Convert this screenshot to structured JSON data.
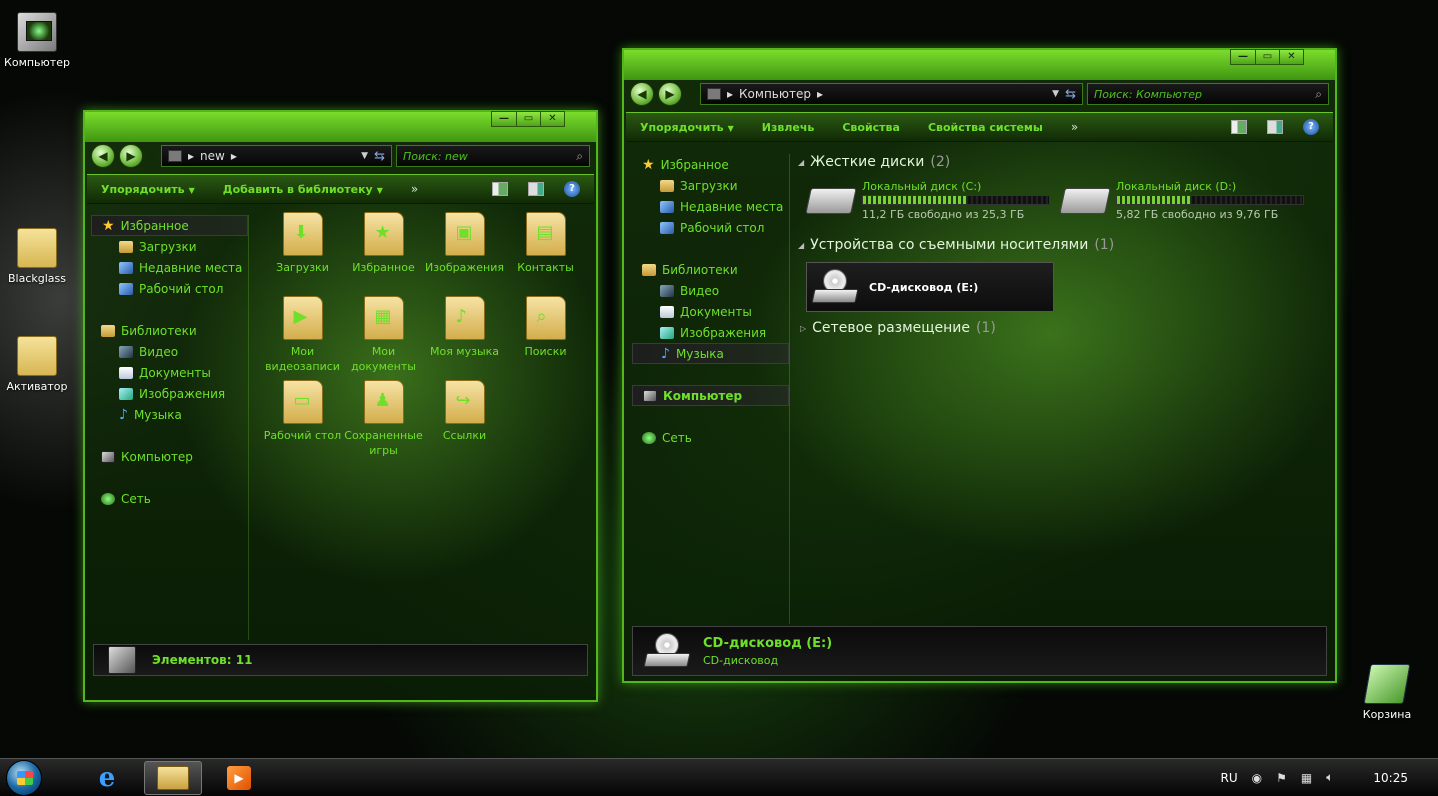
{
  "desktop": {
    "icons": [
      {
        "label": "Компьютер",
        "kind": "computer"
      },
      {
        "label": "Blackglass",
        "kind": "folder"
      },
      {
        "label": "Активатор",
        "kind": "folder"
      },
      {
        "label": "Корзина",
        "kind": "trash"
      }
    ]
  },
  "left_window": {
    "controls": [
      "—",
      "▭",
      "✕"
    ],
    "address": "new",
    "search_placeholder": "Поиск: new",
    "commands": {
      "organize": "Упорядочить",
      "add_library": "Добавить в библиотеку",
      "more": "»"
    },
    "sidebar": {
      "favorites": "Избранное",
      "fav_items": [
        "Загрузки",
        "Недавние места",
        "Рабочий стол"
      ],
      "libraries": "Библиотеки",
      "lib_items": [
        "Видео",
        "Документы",
        "Изображения",
        "Музыка"
      ],
      "computer": "Компьютер",
      "network": "Сеть"
    },
    "items": [
      {
        "label": "Загрузки",
        "glyph": "⬇"
      },
      {
        "label": "Избранное",
        "glyph": "★"
      },
      {
        "label": "Изображения",
        "glyph": "▣"
      },
      {
        "label": "Контакты",
        "glyph": "▤"
      },
      {
        "label": "Мои видеозаписи",
        "glyph": "▶"
      },
      {
        "label": "Мои документы",
        "glyph": "▦"
      },
      {
        "label": "Моя музыка",
        "glyph": "♪"
      },
      {
        "label": "Поиски",
        "glyph": "⌕"
      },
      {
        "label": "Рабочий стол",
        "glyph": "▭"
      },
      {
        "label": "Сохраненные игры",
        "glyph": "♟"
      },
      {
        "label": "Ссылки",
        "glyph": "↪"
      }
    ],
    "status": "Элементов: 11"
  },
  "right_window": {
    "controls": [
      "—",
      "▭",
      "✕"
    ],
    "address": "Компьютер",
    "search_placeholder": "Поиск: Компьютер",
    "commands": {
      "organize": "Упорядочить",
      "eject": "Извлечь",
      "properties": "Свойства",
      "system_properties": "Свойства системы",
      "more": "»"
    },
    "sidebar": {
      "favorites": "Избранное",
      "fav_items": [
        "Загрузки",
        "Недавние места",
        "Рабочий стол"
      ],
      "libraries": "Библиотеки",
      "lib_items": [
        "Видео",
        "Документы",
        "Изображения",
        "Музыка"
      ],
      "computer": "Компьютер",
      "network": "Сеть"
    },
    "sections": {
      "hard_disks": "Жесткие диски",
      "hard_disks_count": "(2)",
      "removable": "Устройства со съемными носителями",
      "removable_count": "(1)",
      "network": "Сетевое размещение",
      "network_count": "(1)"
    },
    "drives": [
      {
        "name": "Локальный диск (C:)",
        "free": "11,2 ГБ свободно из 25,3 ГБ",
        "used_fraction": 0.56
      },
      {
        "name": "Локальный диск (D:)",
        "free": "5,82 ГБ свободно из 9,76 ГБ",
        "used_fraction": 0.4
      }
    ],
    "cd_drive": "CD-дисковод (E:)",
    "details": {
      "name": "CD-дисковод (E:)",
      "type": "CD-дисковод"
    }
  },
  "taskbar": {
    "language": "RU",
    "clock": "10:25",
    "ie_glyph": "e",
    "media_glyph": "▶"
  }
}
